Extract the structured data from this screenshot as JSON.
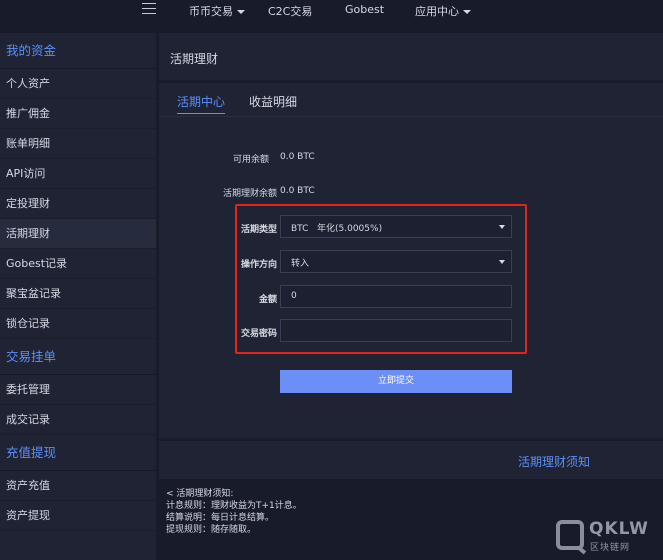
{
  "topnav": {
    "items": [
      {
        "label": "币币交易",
        "dropdown": true
      },
      {
        "label": "C2C交易",
        "dropdown": false
      },
      {
        "label": "Gobest",
        "dropdown": false
      },
      {
        "label": "应用中心",
        "dropdown": true
      }
    ]
  },
  "sidebar": {
    "sections": [
      {
        "title": "我的资金",
        "items": [
          "个人资产",
          "推广佣金",
          "账单明细",
          "API访问",
          "定投理财",
          "活期理财",
          "Gobest记录",
          "聚宝盆记录",
          "锁仓记录"
        ]
      },
      {
        "title": "交易挂单",
        "items": [
          "委托管理",
          "成交记录"
        ]
      },
      {
        "title": "充值提现",
        "items": [
          "资产充值",
          "资产提现"
        ]
      }
    ],
    "active_item": "活期理财"
  },
  "page": {
    "title": "活期理财",
    "tabs": [
      {
        "label": "活期中心",
        "active": true
      },
      {
        "label": "收益明细",
        "active": false
      }
    ],
    "available_label": "可用余额",
    "available_value": "0.0 BTC",
    "savings_label": "活期理财余额",
    "savings_value": "0.0 BTC",
    "form": {
      "type_label": "活期类型",
      "type_value": "BTC   年化(5.0005%)",
      "direction_label": "操作方向",
      "direction_value": "转入",
      "amount_label": "金额",
      "amount_value": "0",
      "password_label": "交易密码",
      "password_value": "",
      "submit_label": "立即提交"
    },
    "notice": {
      "title": "活期理财须知",
      "lines": [
        "< 活期理财须知:",
        "计息规则：理财收益为T+1计息。",
        "结算说明：每日计息结算。",
        "提现规则：随存随取。"
      ]
    }
  },
  "watermark": {
    "text": "QKLW",
    "sub": "区块链网"
  },
  "colors": {
    "accent": "#5b8ff9",
    "button": "#6b8ef7",
    "highlight": "#e0241c",
    "background": "#181b2a",
    "panel": "#1f2334"
  }
}
